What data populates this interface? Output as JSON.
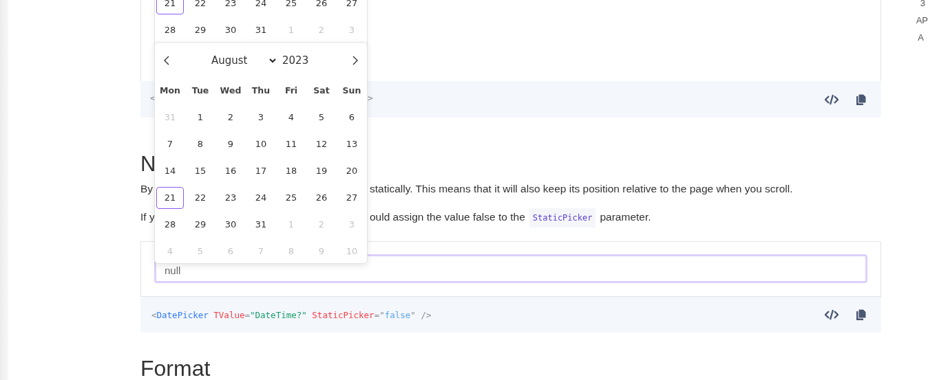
{
  "toc": [
    "3",
    "AP",
    "A"
  ],
  "prev_picker": {
    "weeks": [
      [
        {
          "day": "21",
          "selected": true,
          "outside": false
        },
        {
          "day": "22",
          "selected": false,
          "outside": false
        },
        {
          "day": "23",
          "selected": false,
          "outside": false
        },
        {
          "day": "24",
          "selected": false,
          "outside": false
        },
        {
          "day": "25",
          "selected": false,
          "outside": false
        },
        {
          "day": "26",
          "selected": false,
          "outside": false
        },
        {
          "day": "27",
          "selected": false,
          "outside": false
        }
      ],
      [
        {
          "day": "28",
          "selected": false,
          "outside": false
        },
        {
          "day": "29",
          "selected": false,
          "outside": false
        },
        {
          "day": "30",
          "selected": false,
          "outside": false
        },
        {
          "day": "31",
          "selected": false,
          "outside": false
        },
        {
          "day": "1",
          "selected": false,
          "outside": true
        },
        {
          "day": "2",
          "selected": false,
          "outside": true
        },
        {
          "day": "3",
          "selected": false,
          "outside": true
        }
      ]
    ]
  },
  "example_top": {
    "code_fragments": [
      "<",
      ">"
    ]
  },
  "picker": {
    "month": "August",
    "year": "2023",
    "weekdays": [
      "Mon",
      "Tue",
      "Wed",
      "Thu",
      "Fri",
      "Sat",
      "Sun"
    ],
    "weeks": [
      [
        {
          "day": "31",
          "selected": false,
          "outside": true
        },
        {
          "day": "1",
          "selected": false,
          "outside": false
        },
        {
          "day": "2",
          "selected": false,
          "outside": false
        },
        {
          "day": "3",
          "selected": false,
          "outside": false
        },
        {
          "day": "4",
          "selected": false,
          "outside": false
        },
        {
          "day": "5",
          "selected": false,
          "outside": false
        },
        {
          "day": "6",
          "selected": false,
          "outside": false
        }
      ],
      [
        {
          "day": "7",
          "selected": false,
          "outside": false
        },
        {
          "day": "8",
          "selected": false,
          "outside": false
        },
        {
          "day": "9",
          "selected": false,
          "outside": false
        },
        {
          "day": "10",
          "selected": false,
          "outside": false
        },
        {
          "day": "11",
          "selected": false,
          "outside": false
        },
        {
          "day": "12",
          "selected": false,
          "outside": false
        },
        {
          "day": "13",
          "selected": false,
          "outside": false
        }
      ],
      [
        {
          "day": "14",
          "selected": false,
          "outside": false
        },
        {
          "day": "15",
          "selected": false,
          "outside": false
        },
        {
          "day": "16",
          "selected": false,
          "outside": false
        },
        {
          "day": "17",
          "selected": false,
          "outside": false
        },
        {
          "day": "18",
          "selected": false,
          "outside": false
        },
        {
          "day": "19",
          "selected": false,
          "outside": false
        },
        {
          "day": "20",
          "selected": false,
          "outside": false
        }
      ],
      [
        {
          "day": "21",
          "selected": true,
          "outside": false
        },
        {
          "day": "22",
          "selected": false,
          "outside": false
        },
        {
          "day": "23",
          "selected": false,
          "outside": false
        },
        {
          "day": "24",
          "selected": false,
          "outside": false
        },
        {
          "day": "25",
          "selected": false,
          "outside": false
        },
        {
          "day": "26",
          "selected": false,
          "outside": false
        },
        {
          "day": "27",
          "selected": false,
          "outside": false
        }
      ],
      [
        {
          "day": "28",
          "selected": false,
          "outside": false
        },
        {
          "day": "29",
          "selected": false,
          "outside": false
        },
        {
          "day": "30",
          "selected": false,
          "outside": false
        },
        {
          "day": "31",
          "selected": false,
          "outside": false
        },
        {
          "day": "1",
          "selected": false,
          "outside": true
        },
        {
          "day": "2",
          "selected": false,
          "outside": true
        },
        {
          "day": "3",
          "selected": false,
          "outside": true
        }
      ],
      [
        {
          "day": "4",
          "selected": false,
          "outside": true
        },
        {
          "day": "5",
          "selected": false,
          "outside": true
        },
        {
          "day": "6",
          "selected": false,
          "outside": true
        },
        {
          "day": "7",
          "selected": false,
          "outside": true
        },
        {
          "day": "8",
          "selected": false,
          "outside": true
        },
        {
          "day": "9",
          "selected": false,
          "outside": true
        },
        {
          "day": "10",
          "selected": false,
          "outside": true
        }
      ]
    ]
  },
  "section": {
    "heading": "N",
    "paragraph_1": {
      "start": "By",
      "end": "statically. This means that it will also keep its position relative to the page when you scroll."
    },
    "paragraph_2": {
      "start": "If y",
      "before": "ould assign the value false to the",
      "code": "StaticPicker",
      "after": "parameter."
    }
  },
  "example": {
    "input_value": "null",
    "focused": true,
    "code_tokens": [
      {
        "kind": "punct",
        "text": "<"
      },
      {
        "kind": "tag",
        "text": "DatePicker"
      },
      {
        "kind": "attr",
        "text": " TValue"
      },
      {
        "kind": "punct",
        "text": "="
      },
      {
        "kind": "string",
        "text": "\"DateTime?\""
      },
      {
        "kind": "attr",
        "text": " StaticPicker"
      },
      {
        "kind": "punct",
        "text": "=\""
      },
      {
        "kind": "value",
        "text": "false"
      },
      {
        "kind": "punct",
        "text": "\" />"
      }
    ]
  },
  "next_heading": "Format"
}
